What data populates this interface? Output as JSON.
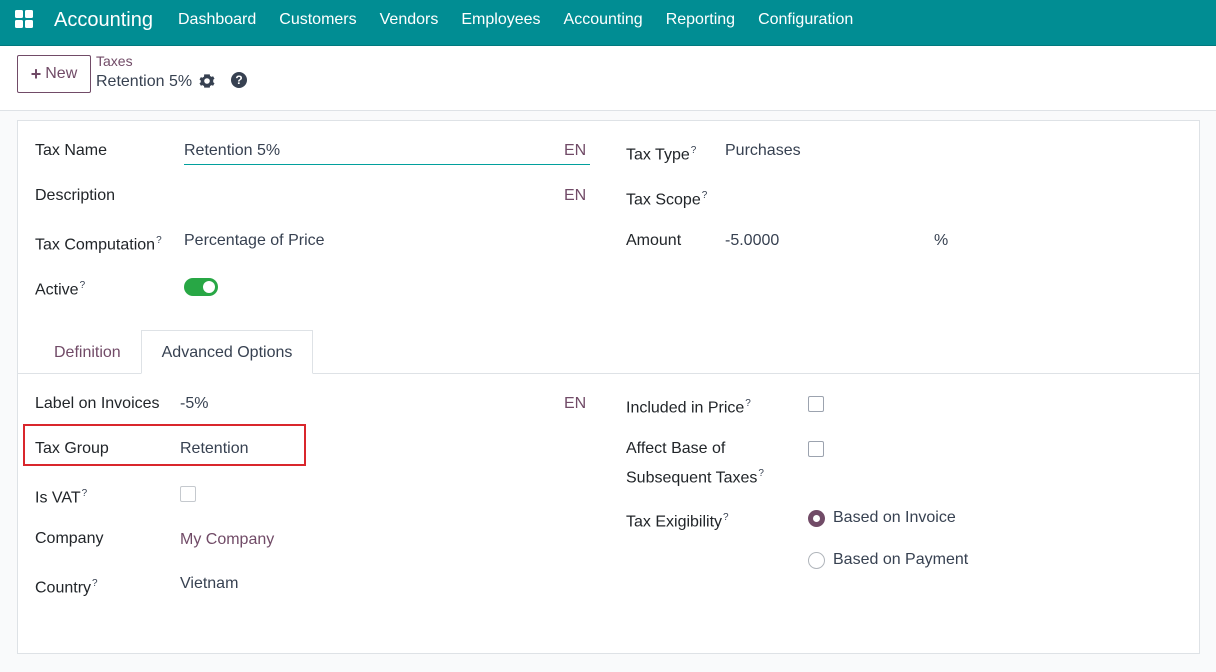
{
  "navbar": {
    "app_name": "Accounting",
    "menu": [
      "Dashboard",
      "Customers",
      "Vendors",
      "Employees",
      "Accounting",
      "Reporting",
      "Configuration"
    ]
  },
  "control_panel": {
    "new_label": "New",
    "breadcrumb": "Taxes",
    "record_title": "Retention 5%",
    "help_glyph": "?"
  },
  "form": {
    "tax_name": {
      "label": "Tax Name",
      "value": "Retention 5%",
      "lang": "EN"
    },
    "description": {
      "label": "Description",
      "value": "",
      "lang": "EN"
    },
    "tax_computation": {
      "label": "Tax Computation",
      "value": "Percentage of Price"
    },
    "active": {
      "label": "Active",
      "value": true
    },
    "tax_type": {
      "label": "Tax Type",
      "value": "Purchases"
    },
    "tax_scope": {
      "label": "Tax Scope",
      "value": ""
    },
    "amount": {
      "label": "Amount",
      "value": "-5.0000",
      "unit": "%"
    },
    "help_mark": "?"
  },
  "tabs": [
    {
      "label": "Definition",
      "active": false
    },
    {
      "label": "Advanced Options",
      "active": true
    }
  ],
  "advanced": {
    "label_on_invoices": {
      "label": "Label on Invoices",
      "value": "-5%",
      "lang": "EN"
    },
    "tax_group": {
      "label": "Tax Group",
      "value": "Retention"
    },
    "is_vat": {
      "label": "Is VAT",
      "checked": false
    },
    "company": {
      "label": "Company",
      "value": "My Company"
    },
    "country": {
      "label": "Country",
      "value": "Vietnam"
    },
    "included_in_price": {
      "label": "Included in Price",
      "checked": false
    },
    "affect_base_line1": "Affect Base of",
    "affect_base_line2": "Subsequent Taxes",
    "affect_base_checked": false,
    "tax_exigibility": {
      "label": "Tax Exigibility",
      "options": [
        "Based on Invoice",
        "Based on Payment"
      ],
      "selected": "Based on Invoice"
    }
  },
  "colors": {
    "navbar": "#018d93",
    "brand_purple": "#714b67",
    "toggle_on": "#28a745",
    "highlight": "#d9262c"
  }
}
